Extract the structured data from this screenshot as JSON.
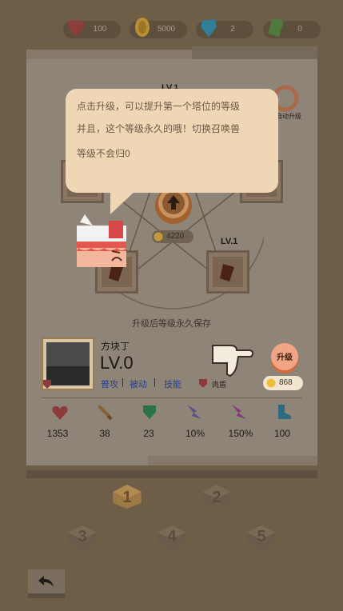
{
  "resources": [
    {
      "icon": "heart-icon",
      "value": "100",
      "color": "#8c3f3a"
    },
    {
      "icon": "coin-icon",
      "value": "5000",
      "color": "#b98f35"
    },
    {
      "icon": "blue-gem-icon",
      "value": "2",
      "color": "#2f7f98"
    },
    {
      "icon": "green-card-icon",
      "value": "0",
      "color": "#4f7a3b"
    }
  ],
  "pentagram": {
    "top_level": "LV.1",
    "right_level": "LV.1",
    "center_cost": "4220",
    "right_top_label": "自动升级",
    "save_note": "升级后等级永久保存"
  },
  "tooltip": {
    "line1": "点击升级，可以提升第一个塔位的等级",
    "line2": "并且，这个等级永久的哦！切换召唤兽",
    "line3": "等级不会归0"
  },
  "hero": {
    "name": "方块丁",
    "level": "LV.0",
    "attack_type": "普攻",
    "passive": "被动",
    "skill": "技能",
    "role": "肉盾",
    "upgrade_label": "升级",
    "upgrade_cost": "868"
  },
  "stats": [
    {
      "icon": "heart-icon",
      "value": "1353",
      "color": "#8c3a3a"
    },
    {
      "icon": "sword-icon",
      "value": "38",
      "color": "#8a6236"
    },
    {
      "icon": "shield-icon",
      "value": "23",
      "color": "#2a7346"
    },
    {
      "icon": "crit-icon",
      "value": "10%",
      "color": "#5a4f8a"
    },
    {
      "icon": "crit-damage-icon",
      "value": "150%",
      "color": "#7c3b72"
    },
    {
      "icon": "boot-icon",
      "value": "100",
      "color": "#2e6a80"
    }
  ],
  "slots": [
    "1",
    "2",
    "3",
    "4",
    "5"
  ]
}
